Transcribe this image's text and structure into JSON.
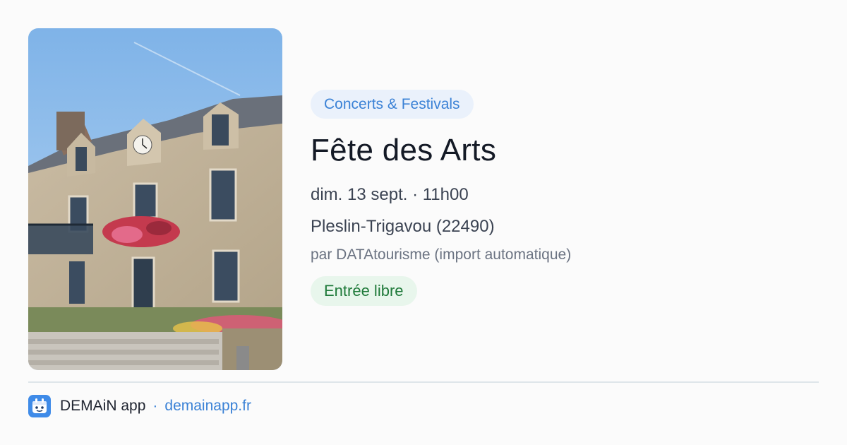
{
  "event": {
    "category": "Concerts & Festivals",
    "title": "Fête des Arts",
    "datetime": "dim. 13 sept. · 11h00",
    "location": "Pleslin-Trigavou (22490)",
    "organizer": "par DATAtourisme (import automatique)",
    "price": "Entrée libre"
  },
  "footer": {
    "app_name": "DEMAiN app",
    "separator": "·",
    "url": "demainapp.fr"
  },
  "colors": {
    "accent": "#3b82d6",
    "category_chip_bg": "#eaf1fb",
    "price_chip_bg": "#e8f6ec",
    "price_text": "#1f7a3a",
    "logo_bg": "#3f8be8"
  },
  "icons": {
    "app_logo": "demain-app-logo-icon"
  }
}
